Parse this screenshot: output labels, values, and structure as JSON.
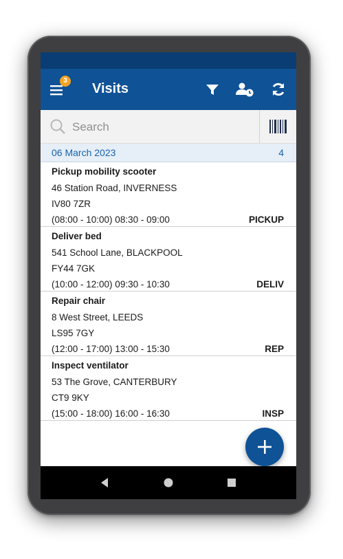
{
  "app": {
    "title": "Visits",
    "menu_badge": "3",
    "primary_color": "#0f5296",
    "status_bar_color": "#0a3d73",
    "badge_color": "#f3a322"
  },
  "toolbar": {
    "icons": [
      "menu-icon",
      "filter-icon",
      "user-clock-icon",
      "refresh-icon"
    ]
  },
  "search": {
    "placeholder": "Search",
    "value": "",
    "icon": "search-icon",
    "barcode_icon": "barcode-icon"
  },
  "group": {
    "date": "06 March 2023",
    "count": "4"
  },
  "visits": [
    {
      "title": "Pickup mobility scooter",
      "address_line1": "46 Station Road, INVERNESS",
      "address_line2": "IV80 7ZR",
      "times": "(08:00 - 10:00) 08:30 - 09:00",
      "type": "PICKUP"
    },
    {
      "title": "Deliver bed",
      "address_line1": "541 School Lane, BLACKPOOL",
      "address_line2": "FY44 7GK",
      "times": "(10:00 - 12:00) 09:30 - 10:30",
      "type": "DELIV"
    },
    {
      "title": "Repair chair",
      "address_line1": "8 West Street, LEEDS",
      "address_line2": "LS95 7GY",
      "times": "(12:00 - 17:00) 13:00 - 15:30",
      "type": "REP"
    },
    {
      "title": "Inspect ventilator",
      "address_line1": "53 The Grove, CANTERBURY",
      "address_line2": "CT9 9KY",
      "times": "(15:00 - 18:00) 16:00 - 16:30",
      "type": "INSP"
    }
  ],
  "fab": {
    "icon": "plus-icon"
  },
  "navigation_bar": {
    "icons": [
      "back-icon",
      "home-icon",
      "recents-icon"
    ]
  }
}
